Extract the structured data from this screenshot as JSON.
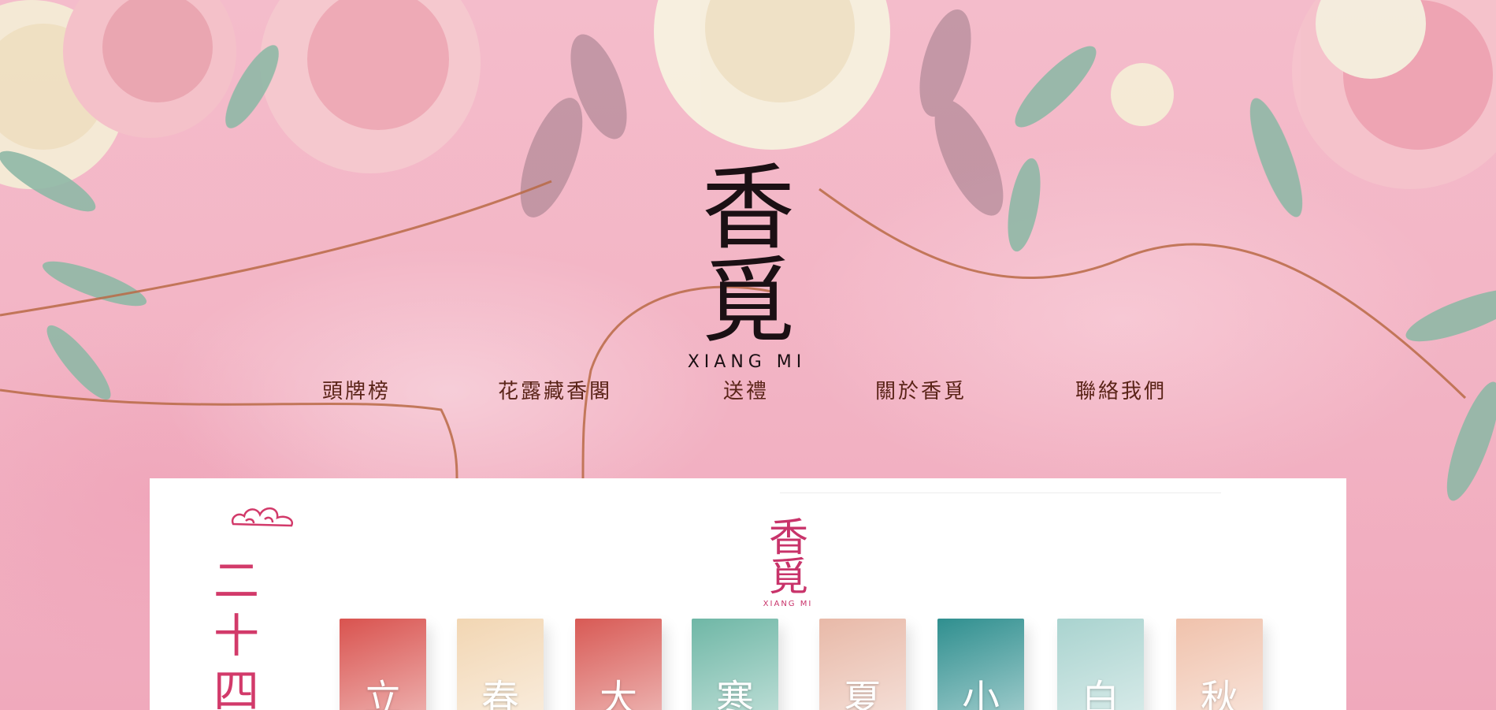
{
  "brand": {
    "logo_mark": "香覓",
    "logo_sub": "XIANG MI"
  },
  "nav": [
    {
      "label": "頭牌榜"
    },
    {
      "label": "花露藏香閣"
    },
    {
      "label": "送禮"
    },
    {
      "label": "關於香覓"
    },
    {
      "label": "聯絡我們"
    }
  ],
  "panel": {
    "vertical_title": "二十四",
    "mini_logo_mark": "香覓",
    "mini_logo_sub": "XIANG MI",
    "boxes": [
      {
        "label": "立",
        "color": "#d9534f"
      },
      {
        "label": "春",
        "color": "#f2d6b3"
      },
      {
        "label": "大",
        "color": "#d85a55"
      },
      {
        "label": "寒",
        "color": "#6fb7a6"
      },
      {
        "label": "夏",
        "color": "#e8b9a8"
      },
      {
        "label": "小",
        "color": "#2f8f8f"
      },
      {
        "label": "白",
        "color": "#a9d3cf"
      },
      {
        "label": "秋",
        "color": "#f0c2ac"
      }
    ]
  },
  "colors": {
    "background": "#f3b6c6",
    "nav_text": "#5a2418",
    "accent": "#d23a6a"
  }
}
